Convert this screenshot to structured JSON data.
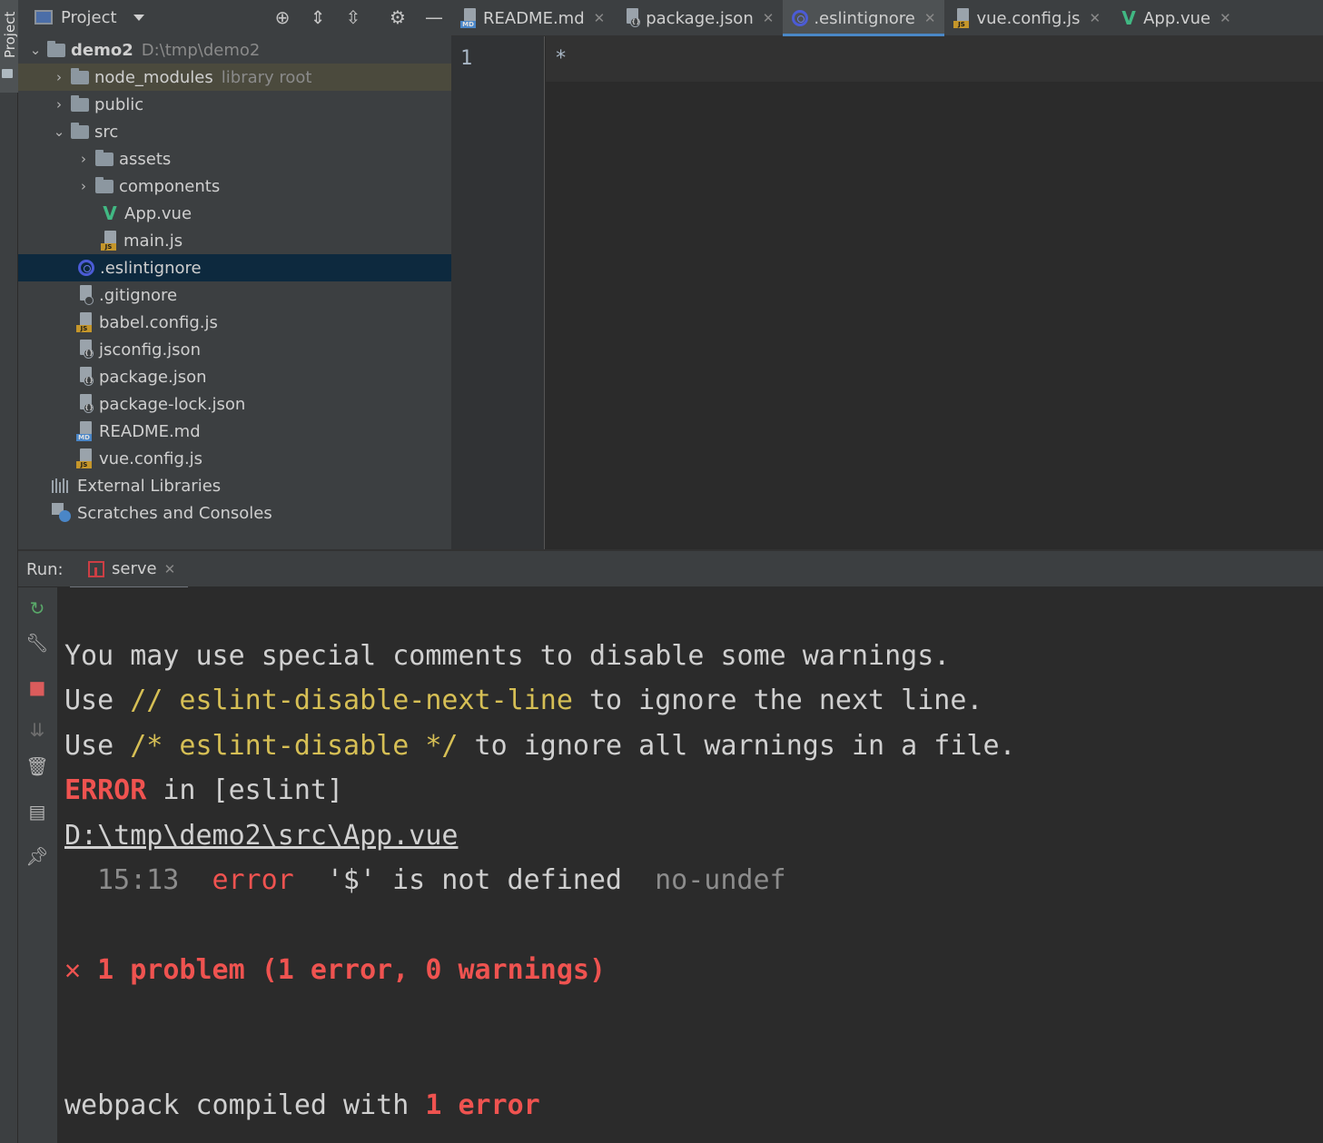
{
  "left_strip": {
    "tab_label": "Project"
  },
  "project": {
    "title": "Project",
    "tree": [
      {
        "label": "demo2",
        "hint": "D:\\tmp\\demo2"
      },
      {
        "label": "node_modules",
        "hint": "library root"
      },
      {
        "label": "public"
      },
      {
        "label": "src"
      },
      {
        "label": "assets"
      },
      {
        "label": "components"
      },
      {
        "label": "App.vue"
      },
      {
        "label": "main.js"
      },
      {
        "label": ".eslintignore"
      },
      {
        "label": ".gitignore"
      },
      {
        "label": "babel.config.js"
      },
      {
        "label": "jsconfig.json"
      },
      {
        "label": "package.json"
      },
      {
        "label": "package-lock.json"
      },
      {
        "label": "README.md"
      },
      {
        "label": "vue.config.js"
      },
      {
        "label": "External Libraries"
      },
      {
        "label": "Scratches and Consoles"
      }
    ]
  },
  "editor": {
    "tabs": [
      {
        "label": "README.md",
        "icon": "markdown-file-icon"
      },
      {
        "label": "package.json",
        "icon": "json-file-icon"
      },
      {
        "label": ".eslintignore",
        "icon": "eslint-icon",
        "active": true
      },
      {
        "label": "vue.config.js",
        "icon": "js-file-icon"
      },
      {
        "label": "App.vue",
        "icon": "vue-icon"
      }
    ],
    "line_number": "1",
    "code": "*"
  },
  "run": {
    "label": "Run:",
    "tab": "serve",
    "console": {
      "l1": "You may use special comments to disable some warnings.",
      "l2_a": "Use ",
      "l2_b": "// eslint-disable-next-line",
      "l2_c": " to ignore the next line.",
      "l3_a": "Use ",
      "l3_b": "/* eslint-disable */",
      "l3_c": " to ignore all warnings in a file.",
      "l4_a": "ERROR",
      "l4_b": " in [eslint]",
      "l5": "D:\\tmp\\demo2\\src\\App.vue",
      "l6_pos": "15:13",
      "l6_level": "error",
      "l6_msg": "'$' is not defined",
      "l6_rule": "no-undef",
      "l7": "1 problem (1 error, 0 warnings)",
      "l8_a": "webpack compiled with ",
      "l8_b": "1 error"
    }
  },
  "colors": {
    "accent": "#4a88c7",
    "error": "#ef5350",
    "highlight": "#d6bf55",
    "selection": "#0d293e"
  }
}
